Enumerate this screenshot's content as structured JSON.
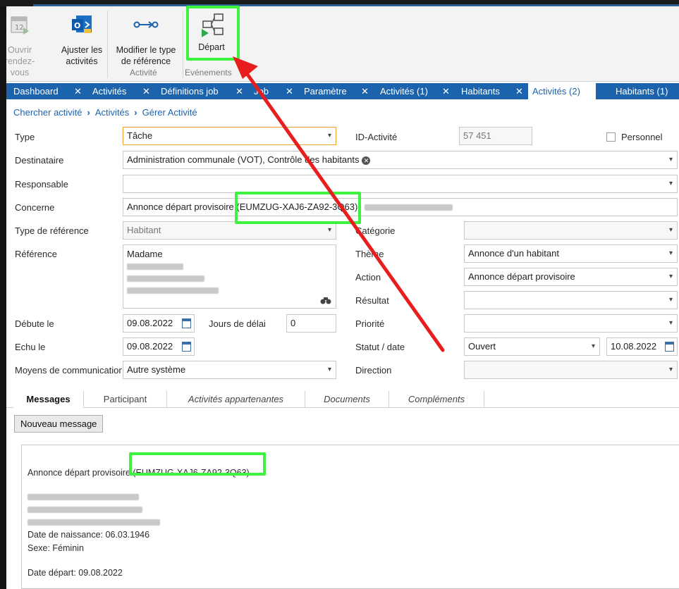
{
  "ribbon": {
    "open_appt_line1": "Ouvrir",
    "open_appt_line2": "rendez-vous",
    "adjust_line1": "Ajuster les",
    "adjust_line2": "activités",
    "modify_line1": "Modifier le type",
    "modify_line2": "de référence",
    "group_activite": "Activité",
    "depart_label": "Départ",
    "group_evenements": "Evénements"
  },
  "tabs": [
    {
      "label": "Dashboard"
    },
    {
      "label": "Activités"
    },
    {
      "label": "Définitions job"
    },
    {
      "label": "Job"
    },
    {
      "label": "Paramètre"
    },
    {
      "label": "Activités (1)"
    },
    {
      "label": "Habitants"
    },
    {
      "label": "Activités (2)"
    },
    {
      "label": "Habitants (1)"
    }
  ],
  "tab_close": "✕",
  "breadcrumb": [
    "Chercher activité",
    "Activités",
    "Gérer Activité"
  ],
  "breadcrumb_sep": "›",
  "form": {
    "type_label": "Type",
    "type_value": "Tâche",
    "id_label": "ID-Activité",
    "id_value": "57 451",
    "personal_label": "Personnel",
    "recipient_label": "Destinataire",
    "recipient_value": "Administration communale (VOT), Contrôle des habitants",
    "responsible_label": "Responsable",
    "concerne_label": "Concerne",
    "concerne_value": "Annonce départ provisoire (EUMZUG-XAJ6-ZA92-3Q63)",
    "reftype_label": "Type de référence",
    "reftype_value": "Habitant",
    "category_label": "Catégorie",
    "reference_label": "Référence",
    "reference_value": "Madame",
    "theme_label": "Thème",
    "theme_value": "Annonce d'un habitant",
    "action_label": "Action",
    "action_value": "Annonce départ provisoire",
    "result_label": "Résultat",
    "start_label": "Débute le",
    "start_value": "09.08.2022",
    "delay_label": "Jours de délai",
    "delay_value": "0",
    "priority_label": "Priorité",
    "due_label": "Echu le",
    "due_value": "09.08.2022",
    "status_label": "Statut / date",
    "status_value": "Ouvert",
    "status_date": "10.08.2022",
    "comm_label": "Moyens de communication",
    "comm_value": "Autre système",
    "direction_label": "Direction"
  },
  "bottom_tabs": [
    "Messages",
    "Participant",
    "Activités appartenantes",
    "Documents",
    "Compléments"
  ],
  "new_message_button": "Nouveau message",
  "message": {
    "subject": "Annonce départ provisoire (EUMZUG-XAJ6-ZA92-3Q63)",
    "birth": "Date de naissance: 06.03.1946",
    "sex": "Sexe: Féminin",
    "departure": "Date départ: 09.08.2022"
  },
  "colors": {
    "tab_blue": "#1c63ad",
    "highlight_green": "#3ff23f",
    "arrow_red": "#e81e1e",
    "field_focus_orange": "#f0a030"
  },
  "icons": {
    "open_appointment": "calendar-icon",
    "adjust": "outlook-icon",
    "modify_reftype": "link-arrow-icon",
    "depart": "flow-diagram-icon",
    "calendar_picker": "calendar-icon",
    "lookup": "binoculars-icon"
  }
}
